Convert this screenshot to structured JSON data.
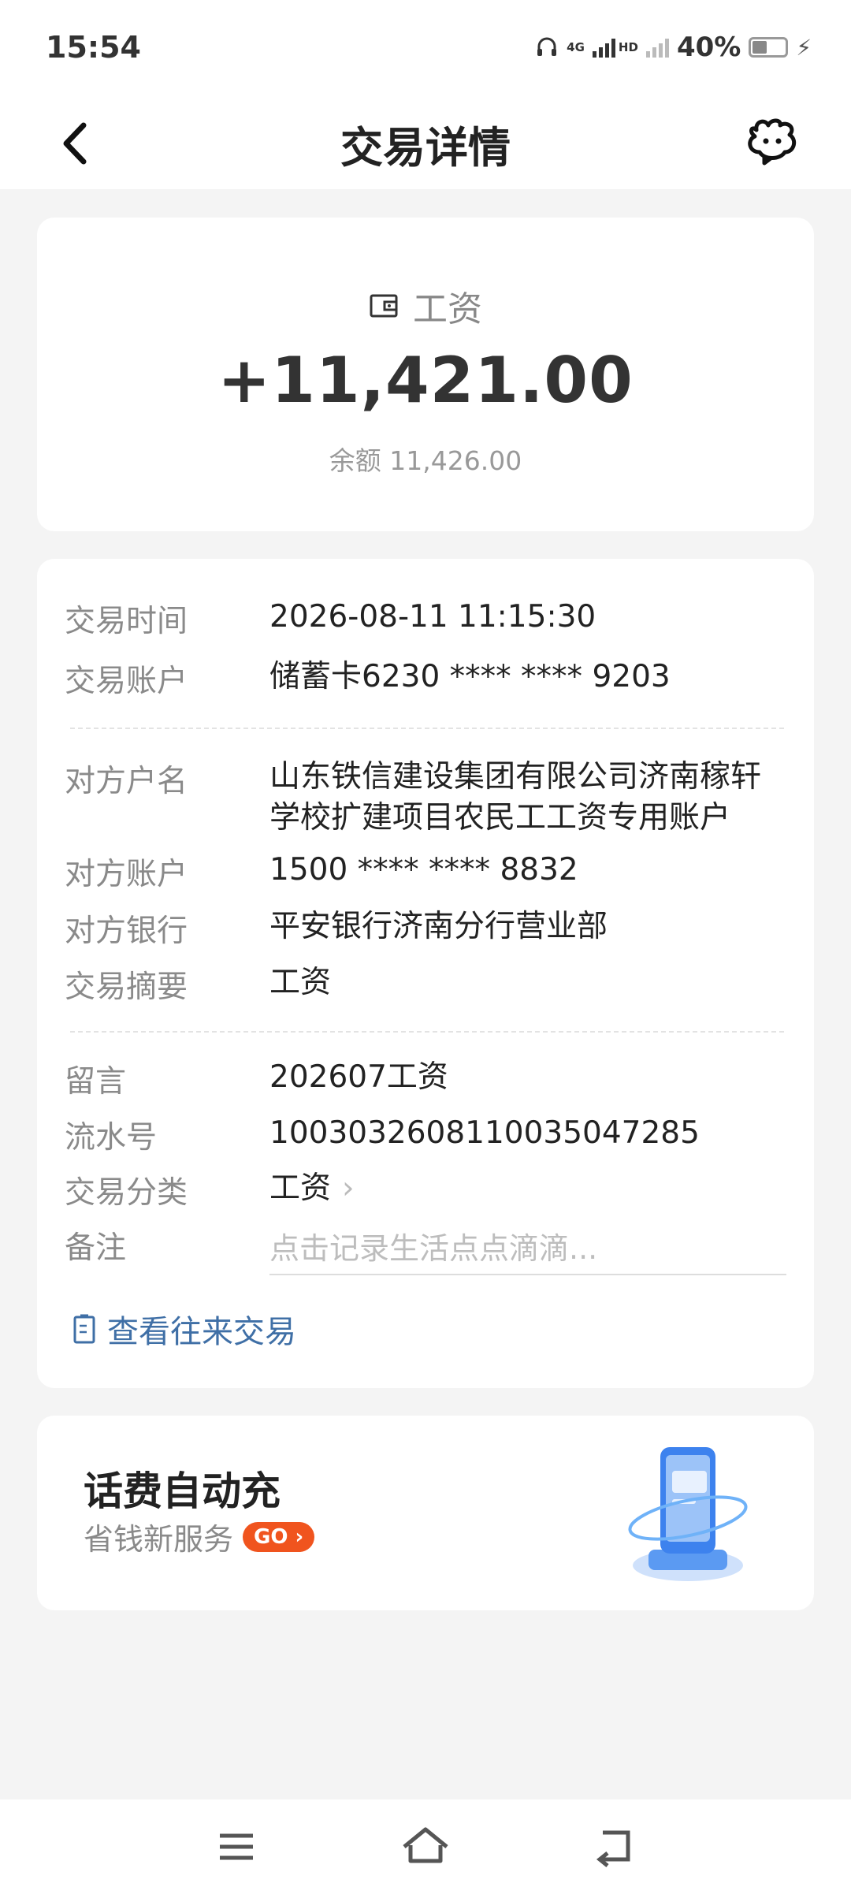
{
  "status_bar": {
    "time": "15:54",
    "network_type": "4G",
    "network_hd": "HD",
    "battery": "40%"
  },
  "header": {
    "title": "交易详情"
  },
  "summary": {
    "category": "工资",
    "amount": "+11,421.00",
    "balance": "余额 11,426.00"
  },
  "details": {
    "time_label": "交易时间",
    "time_value": "2026-08-11 11:15:30",
    "account_label": "交易账户",
    "account_value": "储蓄卡6230 **** **** 9203",
    "payee_name_label": "对方户名",
    "payee_name_line1": "山东铁信建设集团有限公司济南稼轩",
    "payee_name_line2": "学校扩建项目农民工工资专用账户",
    "payee_account_label": "对方账户",
    "payee_account_value": "1500 **** **** 8832",
    "payee_bank_label": "对方银行",
    "payee_bank_value": "平安银行济南分行营业部",
    "summary_label": "交易摘要",
    "summary_value": "工资",
    "message_label": "留言",
    "message_value": "202607工资",
    "serial_label": "流水号",
    "serial_value": "10030326081100350472​85",
    "category_label": "交易分类",
    "category_value": "工资",
    "remark_label": "备注",
    "remark_placeholder": "点击记录生活点点滴滴...",
    "history_link": "查看往来交易"
  },
  "promo": {
    "title": "话费自动充",
    "subtitle": "省钱新服务",
    "go_label": "GO"
  },
  "colors": {
    "link": "#3f6fa6",
    "go_button": "#f0541e",
    "background": "#f4f4f4"
  }
}
